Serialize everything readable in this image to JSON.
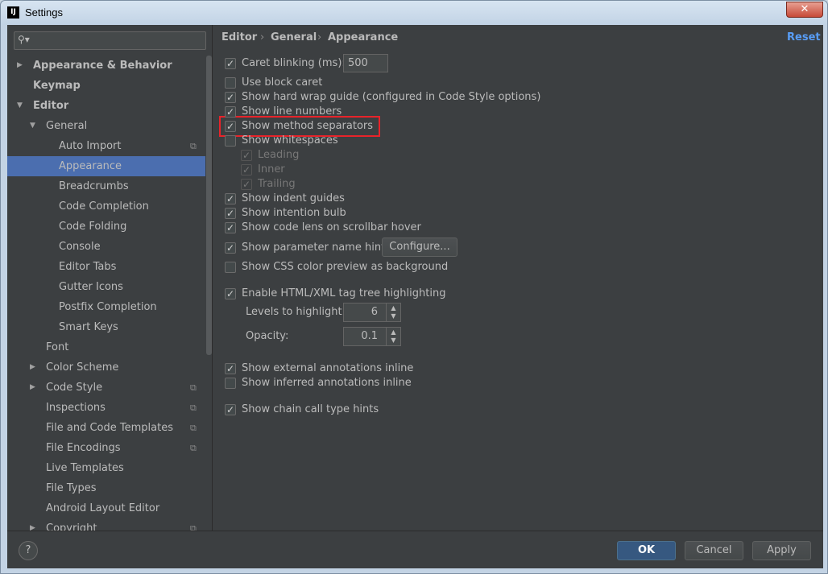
{
  "window": {
    "title": "Settings",
    "app_icon_text": "IJ",
    "close_glyph": "✕"
  },
  "sidebar": {
    "search": {
      "value": "",
      "icon": "search-icon"
    },
    "items": [
      {
        "label": "Appearance & Behavior",
        "level": 0,
        "arrow": "▶",
        "bold": true
      },
      {
        "label": "Keymap",
        "level": 0,
        "arrow": "",
        "bold": true
      },
      {
        "label": "Editor",
        "level": 0,
        "arrow": "▼",
        "bold": true
      },
      {
        "label": "General",
        "level": 1,
        "arrow": "▼"
      },
      {
        "label": "Auto Import",
        "level": 2,
        "badge": true
      },
      {
        "label": "Appearance",
        "level": 2,
        "selected": true
      },
      {
        "label": "Breadcrumbs",
        "level": 2
      },
      {
        "label": "Code Completion",
        "level": 2
      },
      {
        "label": "Code Folding",
        "level": 2
      },
      {
        "label": "Console",
        "level": 2
      },
      {
        "label": "Editor Tabs",
        "level": 2
      },
      {
        "label": "Gutter Icons",
        "level": 2
      },
      {
        "label": "Postfix Completion",
        "level": 2
      },
      {
        "label": "Smart Keys",
        "level": 2
      },
      {
        "label": "Font",
        "level": 1
      },
      {
        "label": "Color Scheme",
        "level": 1,
        "arrow": "▶"
      },
      {
        "label": "Code Style",
        "level": 1,
        "arrow": "▶",
        "badge": true
      },
      {
        "label": "Inspections",
        "level": 1,
        "badge": true
      },
      {
        "label": "File and Code Templates",
        "level": 1,
        "badge": true
      },
      {
        "label": "File Encodings",
        "level": 1,
        "badge": true
      },
      {
        "label": "Live Templates",
        "level": 1
      },
      {
        "label": "File Types",
        "level": 1
      },
      {
        "label": "Android Layout Editor",
        "level": 1
      },
      {
        "label": "Copyright",
        "level": 1,
        "arrow": "▶",
        "badge": true
      }
    ]
  },
  "breadcrumb": {
    "items": [
      "Editor",
      "General",
      "Appearance"
    ],
    "separator": "›"
  },
  "reset_label": "Reset",
  "options": {
    "caret_blinking": {
      "label": "Caret blinking (ms):",
      "checked": true,
      "value": "500"
    },
    "use_block_caret": {
      "label": "Use block caret",
      "checked": false
    },
    "hard_wrap_guide": {
      "label": "Show hard wrap guide (configured in Code Style options)",
      "checked": true
    },
    "line_numbers": {
      "label": "Show line numbers",
      "checked": true
    },
    "method_separators": {
      "label": "Show method separators",
      "checked": true
    },
    "whitespaces": {
      "label": "Show whitespaces",
      "checked": false
    },
    "leading": {
      "label": "Leading",
      "checked": true
    },
    "inner": {
      "label": "Inner",
      "checked": true
    },
    "trailing": {
      "label": "Trailing",
      "checked": true
    },
    "indent_guides": {
      "label": "Show indent guides",
      "checked": true
    },
    "intention_bulb": {
      "label": "Show intention bulb",
      "checked": true
    },
    "code_lens": {
      "label": "Show code lens on scrollbar hover",
      "checked": true
    },
    "parameter_hints": {
      "label": "Show parameter name hints",
      "checked": true,
      "button": "Configure..."
    },
    "css_color_preview": {
      "label": "Show CSS color preview as background",
      "checked": false
    },
    "tag_tree": {
      "label": "Enable HTML/XML tag tree highlighting",
      "checked": true
    },
    "levels": {
      "label": "Levels to highlight:",
      "value": "6"
    },
    "opacity": {
      "label": "Opacity:",
      "value": "0.1"
    },
    "external_annotations": {
      "label": "Show external annotations inline",
      "checked": true
    },
    "inferred_annotations": {
      "label": "Show inferred annotations inline",
      "checked": false
    },
    "chain_call_hints": {
      "label": "Show chain call type hints",
      "checked": true
    }
  },
  "footer": {
    "help": "?",
    "ok": "OK",
    "cancel": "Cancel",
    "apply": "Apply"
  },
  "colors": {
    "selection": "#4b6eaf",
    "link": "#589df6",
    "highlight_box": "#e8232a",
    "ok_button": "#365880"
  }
}
